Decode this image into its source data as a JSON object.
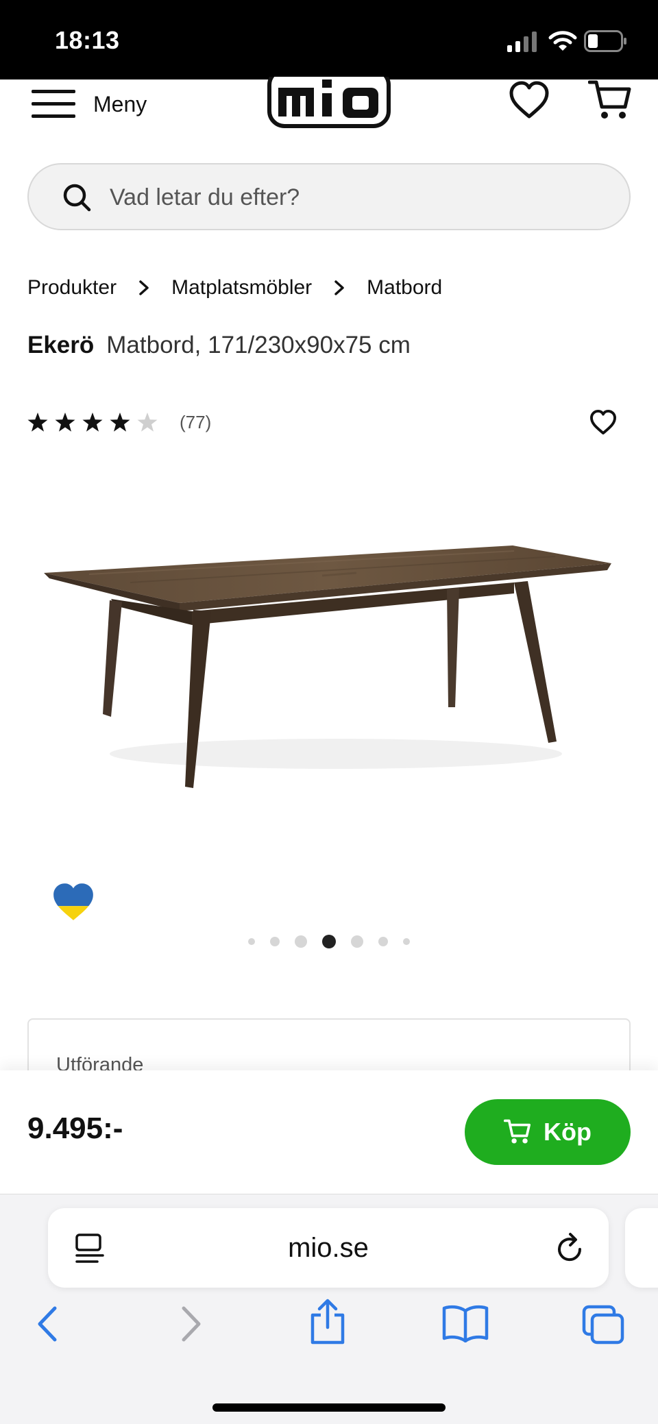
{
  "status_bar": {
    "time": "18:13"
  },
  "header": {
    "menu_label": "Meny",
    "logo_text": "mio"
  },
  "search": {
    "placeholder": "Vad letar du efter?"
  },
  "breadcrumb": [
    "Produkter",
    "Matplatsmöbler",
    "Matbord"
  ],
  "product": {
    "brand": "Ekerö",
    "description": "Matbord, 171/230x90x75 cm",
    "rating": 4.5,
    "rating_max": 5,
    "review_count": "(77)",
    "image_dots": 7,
    "active_image_index": 3
  },
  "option_card": {
    "label": "Utförande"
  },
  "buy_bar": {
    "price": "9.495:-",
    "buy_label": "Köp"
  },
  "browser": {
    "url": "mio.se"
  },
  "colors": {
    "buy_green": "#1fad1f",
    "ios_blue": "#2f7ae5",
    "ukraine_blue": "#2c6bb8",
    "ukraine_yellow": "#f6d20e"
  }
}
